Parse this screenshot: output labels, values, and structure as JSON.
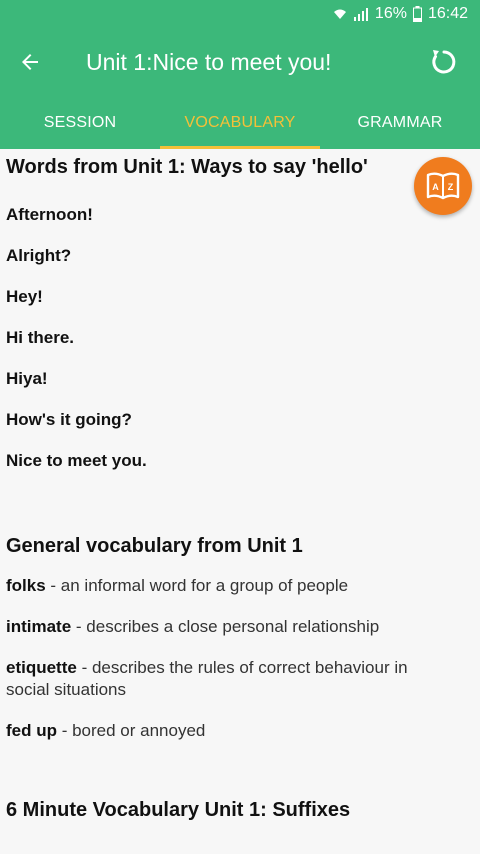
{
  "status": {
    "battery": "16%",
    "time": "16:42"
  },
  "appbar": {
    "title": "Unit 1:Nice to meet you!"
  },
  "tabs": [
    {
      "label": "SESSION"
    },
    {
      "label": "VOCABULARY"
    },
    {
      "label": "GRAMMAR"
    }
  ],
  "section1": {
    "heading": "Words from Unit 1: Ways to say 'hello'",
    "words": [
      "Afternoon!",
      "Alright?",
      "Hey!",
      "Hi there.",
      "Hiya!",
      "How's it going?",
      "Nice to meet you."
    ]
  },
  "section2": {
    "heading": "General vocabulary from Unit 1",
    "items": [
      {
        "term": "folks",
        "definition": " - an informal word for a group of people"
      },
      {
        "term": "intimate",
        "definition": " - describes a close personal relationship"
      },
      {
        "term": "etiquette",
        "definition": " - describes the rules of correct behaviour in social situations"
      },
      {
        "term": "fed up",
        "definition": " - bored or annoyed"
      }
    ]
  },
  "section3": {
    "heading": "6 Minute Vocabulary Unit 1: Suffixes"
  },
  "fab": {
    "icon": "dictionary-icon",
    "color": "#f07c1e"
  },
  "theme": {
    "primary": "#3cb87a",
    "accent": "#f5c038"
  }
}
